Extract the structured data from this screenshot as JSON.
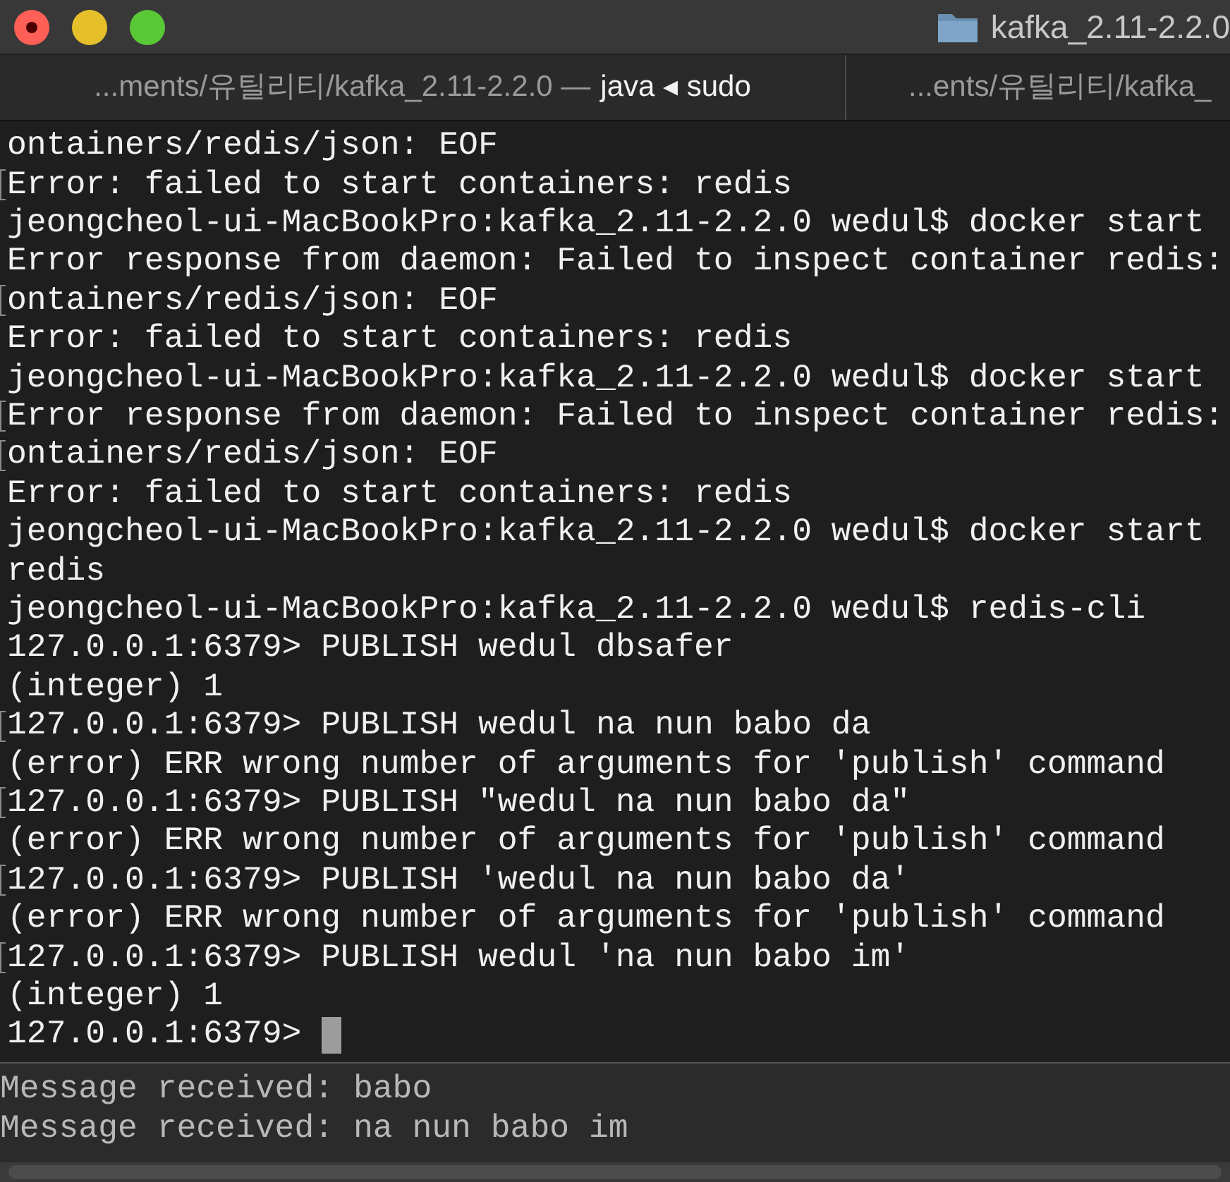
{
  "window": {
    "title": "kafka_2.11-2.2.0"
  },
  "tabs": [
    {
      "path": "...ments/유틸리티/kafka_2.11-2.2.0 —",
      "process": "java ◂ sudo",
      "selected": true
    },
    {
      "path": "...ents/유틸리티/kafka_",
      "selected": false
    }
  ],
  "terminal": {
    "lines": [
      {
        "text": "ontainers/redis/json: EOF",
        "marked": false
      },
      {
        "text": "Error: failed to start containers: redis",
        "marked": true
      },
      {
        "text": "jeongcheol-ui-MacBookPro:kafka_2.11-2.2.0 wedul$ docker start",
        "marked": false
      },
      {
        "text": "Error response from daemon: Failed to inspect container redis:",
        "marked": false
      },
      {
        "text": "ontainers/redis/json: EOF",
        "marked": true
      },
      {
        "text": "Error: failed to start containers: redis",
        "marked": false
      },
      {
        "text": "jeongcheol-ui-MacBookPro:kafka_2.11-2.2.0 wedul$ docker start",
        "marked": false
      },
      {
        "text": "Error response from daemon: Failed to inspect container redis:",
        "marked": true
      },
      {
        "text": "ontainers/redis/json: EOF",
        "marked": true
      },
      {
        "text": "Error: failed to start containers: redis",
        "marked": false
      },
      {
        "text": "jeongcheol-ui-MacBookPro:kafka_2.11-2.2.0 wedul$ docker start",
        "marked": false
      },
      {
        "text": "redis",
        "marked": false
      },
      {
        "text": "jeongcheol-ui-MacBookPro:kafka_2.11-2.2.0 wedul$ redis-cli",
        "marked": false
      },
      {
        "text": "127.0.0.1:6379> PUBLISH wedul dbsafer",
        "marked": false
      },
      {
        "text": "(integer) 1",
        "marked": false
      },
      {
        "text": "127.0.0.1:6379> PUBLISH wedul na nun babo da",
        "marked": true
      },
      {
        "text": "(error) ERR wrong number of arguments for 'publish' command",
        "marked": false
      },
      {
        "text": "127.0.0.1:6379> PUBLISH \"wedul na nun babo da\"",
        "marked": true
      },
      {
        "text": "(error) ERR wrong number of arguments for 'publish' command",
        "marked": false
      },
      {
        "text": "127.0.0.1:6379> PUBLISH 'wedul na nun babo da'",
        "marked": true
      },
      {
        "text": "(error) ERR wrong number of arguments for 'publish' command",
        "marked": false
      },
      {
        "text": "127.0.0.1:6379> PUBLISH wedul 'na nun babo im'",
        "marked": true
      },
      {
        "text": "(integer) 1",
        "marked": false
      },
      {
        "text": "127.0.0.1:6379>",
        "marked": false,
        "cursor": true
      }
    ]
  },
  "lower_pane": {
    "lines": [
      "Message received: babo",
      "Message received: na nun babo im"
    ]
  }
}
